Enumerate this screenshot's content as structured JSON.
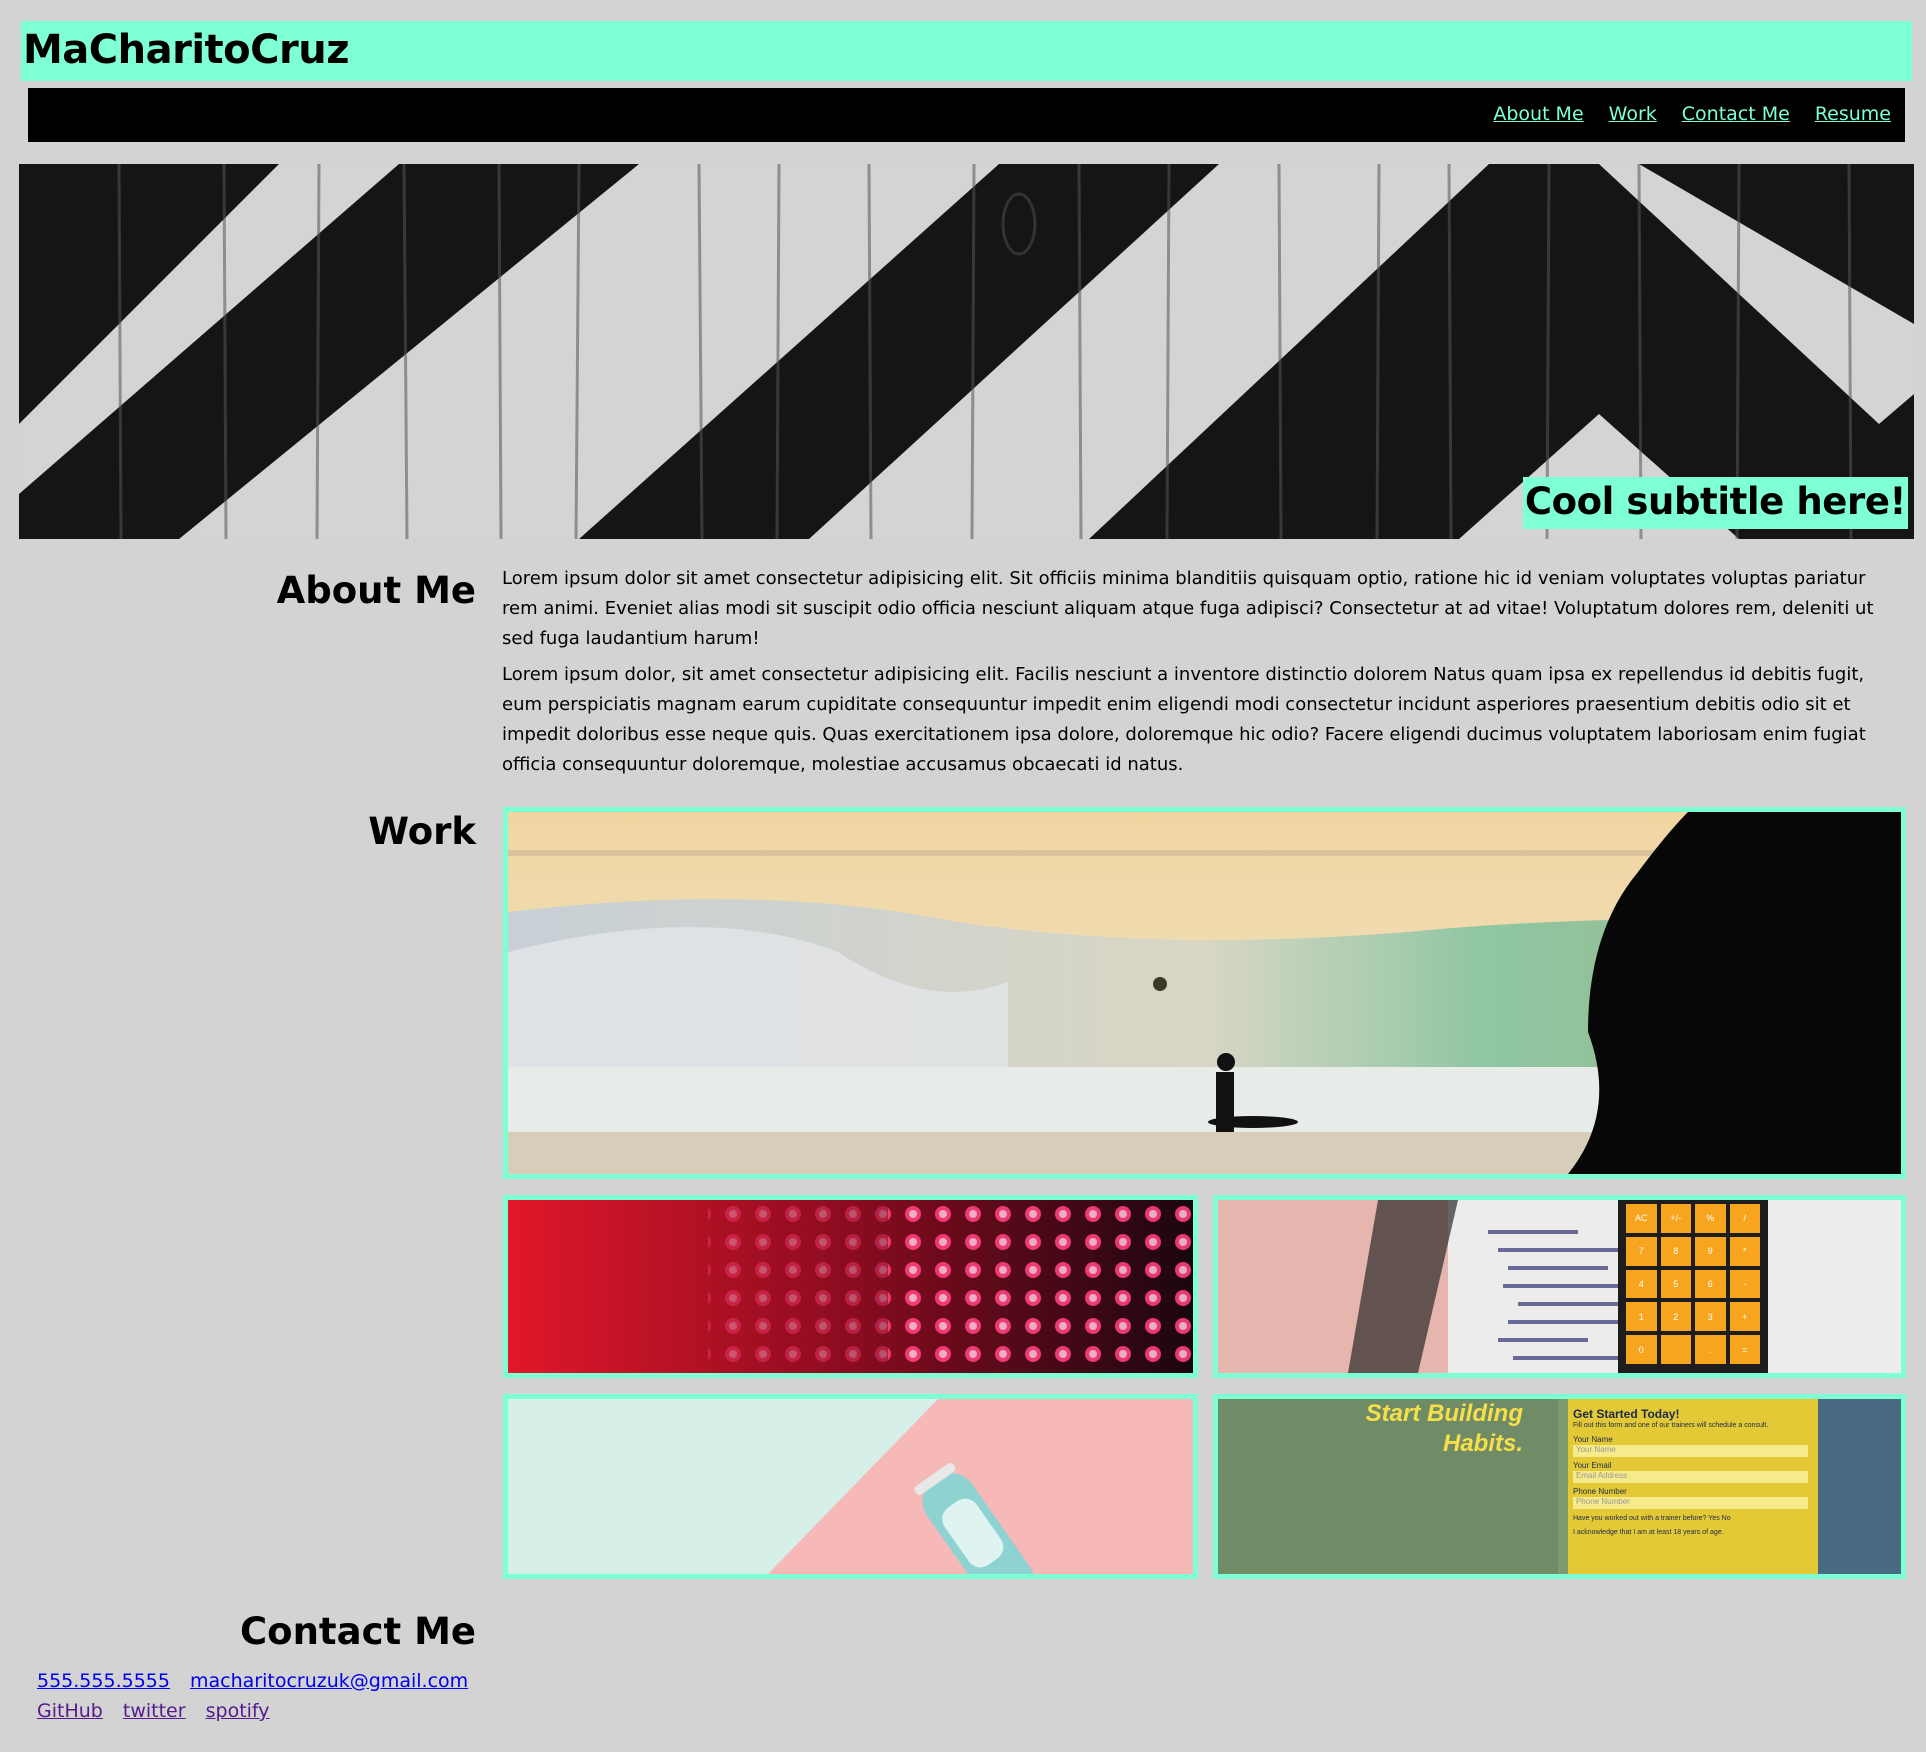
{
  "header": {
    "title": "MaCharitoCruz"
  },
  "nav": {
    "items": [
      "About Me",
      "Work",
      "Contact Me",
      "Resume"
    ]
  },
  "hero": {
    "subtitle": "Cool subtitle here!"
  },
  "about": {
    "heading": "About Me",
    "paragraphs": [
      "Lorem ipsum dolor sit amet consectetur adipisicing elit. Sit officiis minima blanditiis quisquam optio, ratione hic id veniam voluptates voluptas pariatur rem animi. Eveniet alias modi sit suscipit odio officia nesciunt aliquam atque fuga adipisci? Consectetur at ad vitae! Voluptatum dolores rem, deleniti ut sed fuga laudantium harum!",
      "Lorem ipsum dolor, sit amet consectetur adipisicing elit. Facilis nesciunt a inventore distinctio dolorem Natus quam ipsa ex repellendus id debitis fugit, eum perspiciatis magnam earum cupiditate consequuntur impedit enim eligendi modi consectetur incidunt asperiores praesentium debitis odio sit et impedit doloribus esse neque quis. Quas exercitationem ipsa dolore, doloremque hic odio? Facere eligendi ducimus voluptatem laboriosam enim fugiat officia consequuntur doloremque, molestiae accusamus obcaecati id natus."
    ]
  },
  "work": {
    "heading": "Work",
    "habits_card": {
      "headline_1": "Start Building",
      "headline_2": "Habits.",
      "form_title": "Get Started Today!",
      "form_sub": "Fill out this form and one of our trainers will schedule a consult.",
      "name_label": "Your Name",
      "name_placeholder": "Your Name",
      "email_label": "Your Email",
      "email_placeholder": "Email Address",
      "phone_label": "Phone Number",
      "phone_placeholder": "Phone Number",
      "question": "Have you worked out with a trainer before?",
      "yes": "Yes",
      "no": "No",
      "ack": "I acknowledge that I am at least 18 years of age."
    },
    "calculator_keys": [
      "AC",
      "+/-",
      "%",
      "/",
      "7",
      "8",
      "9",
      "*",
      "4",
      "5",
      "6",
      "-",
      "1",
      "2",
      "3",
      "+",
      "0",
      "",
      ".",
      "="
    ]
  },
  "contact": {
    "heading": "Contact Me",
    "phone": "555.555.5555",
    "email": "macharitocruzuk@gmail.com",
    "links": [
      "GitHub",
      "twitter",
      "spotify"
    ]
  },
  "colors": {
    "accent": "#7fffd4",
    "background": "#d3d3d3",
    "nav_bg": "#000000",
    "link": "#0000ee",
    "link_visited": "#551a8b"
  }
}
